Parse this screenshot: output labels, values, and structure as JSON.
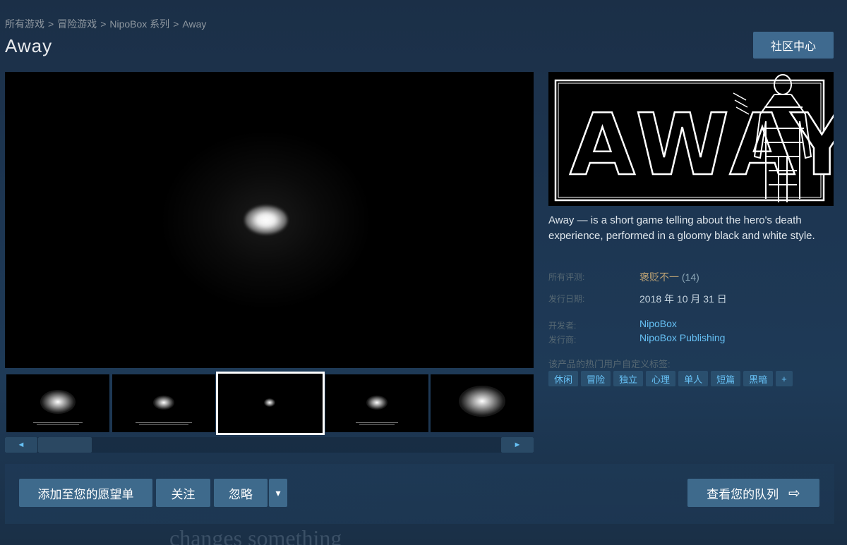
{
  "breadcrumb": {
    "items": [
      "所有游戏",
      "冒险游戏",
      "NipoBox 系列",
      "Away"
    ],
    "separator": ">"
  },
  "game": {
    "title": "Away",
    "description": "Away — is a short game telling about the hero's death experience, performed in a gloomy black and white style."
  },
  "header": {
    "community_label": "社区中心"
  },
  "capsule": {
    "logo_text": "AWAY"
  },
  "info": {
    "reviews_label": "所有评测:",
    "reviews_value": "褒贬不一",
    "reviews_count": "(14)",
    "release_label": "发行日期:",
    "release_value": "2018 年 10 月 31 日",
    "developer_label": "开发者:",
    "developer_value": "NipoBox",
    "publisher_label": "发行商:",
    "publisher_value": "NipoBox Publishing"
  },
  "tags": {
    "label": "该产品的热门用户自定义标签:",
    "items": [
      "休闲",
      "冒险",
      "独立",
      "心理",
      "单人",
      "短篇",
      "黑暗",
      "+"
    ]
  },
  "media": {
    "selected_thumbnail": 3,
    "thumbnail_count": 5,
    "scroll_left_icon": "◄",
    "scroll_right_icon": "►"
  },
  "actions": {
    "wishlist_label": "添加至您的愿望单",
    "follow_label": "关注",
    "ignore_label": "忽略",
    "dropdown_icon": "▾",
    "queue_label": "查看您的队列",
    "queue_icon": "⇨"
  },
  "footer": {
    "partial_text": "changes something"
  },
  "colors": {
    "link": "#66c0f4",
    "review_mixed": "#b9a074",
    "button": "#3e6a8c",
    "tag_bg": "#2a4f6e"
  }
}
